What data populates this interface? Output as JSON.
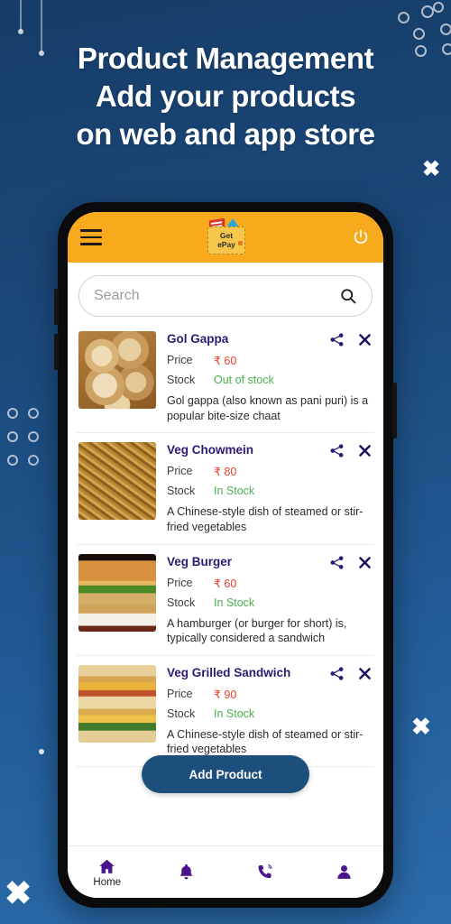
{
  "headline": {
    "line1": "Product Management",
    "line2": "Add your products",
    "line3": "on web and app store"
  },
  "colors": {
    "background_top": "#173d68",
    "background_bottom": "#2a6bab",
    "appbar": "#f9a91c",
    "product_name": "#2e1a73",
    "price": "#e8412f",
    "stock": "#4caf50",
    "add_button": "#1d4f7c",
    "nav_icon": "#4a148c"
  },
  "app": {
    "appbar": {
      "menu_icon": "hamburger-menu-icon",
      "logo_line1": "Get",
      "logo_line2": "ePay",
      "power_icon": "power-icon"
    },
    "search": {
      "placeholder": "Search",
      "value": "",
      "icon": "search-icon"
    },
    "labels": {
      "price": "Price",
      "stock": "Stock",
      "share_icon": "share-icon",
      "close_icon": "close-icon"
    },
    "products": [
      {
        "name": "Gol Gappa",
        "price": "₹ 60",
        "stock": "Out of stock",
        "description": "Gol gappa (also known as pani puri) is a popular bite-size chaat",
        "thumb_class": "th-golgappa"
      },
      {
        "name": "Veg Chowmein",
        "price": "₹ 80",
        "stock": "In Stock",
        "description": "A Chinese-style dish of steamed or stir-fried vegetables",
        "thumb_class": "th-chowmein"
      },
      {
        "name": "Veg Burger",
        "price": "₹ 60",
        "stock": "In Stock",
        "description": "A hamburger (or burger for short) is, typically considered a sandwich",
        "thumb_class": "th-burger"
      },
      {
        "name": "Veg Grilled Sandwich",
        "price": "₹ 90",
        "stock": "In Stock",
        "description": "A Chinese-style dish of steamed or stir-fried vegetables",
        "thumb_class": "th-sandwich"
      }
    ],
    "add_product_label": "Add Product",
    "bottom_nav": [
      {
        "icon": "home-icon",
        "label": "Home"
      },
      {
        "icon": "notification-bell-icon",
        "label": ""
      },
      {
        "icon": "phone-call-icon",
        "label": ""
      },
      {
        "icon": "user-profile-icon",
        "label": ""
      }
    ]
  }
}
